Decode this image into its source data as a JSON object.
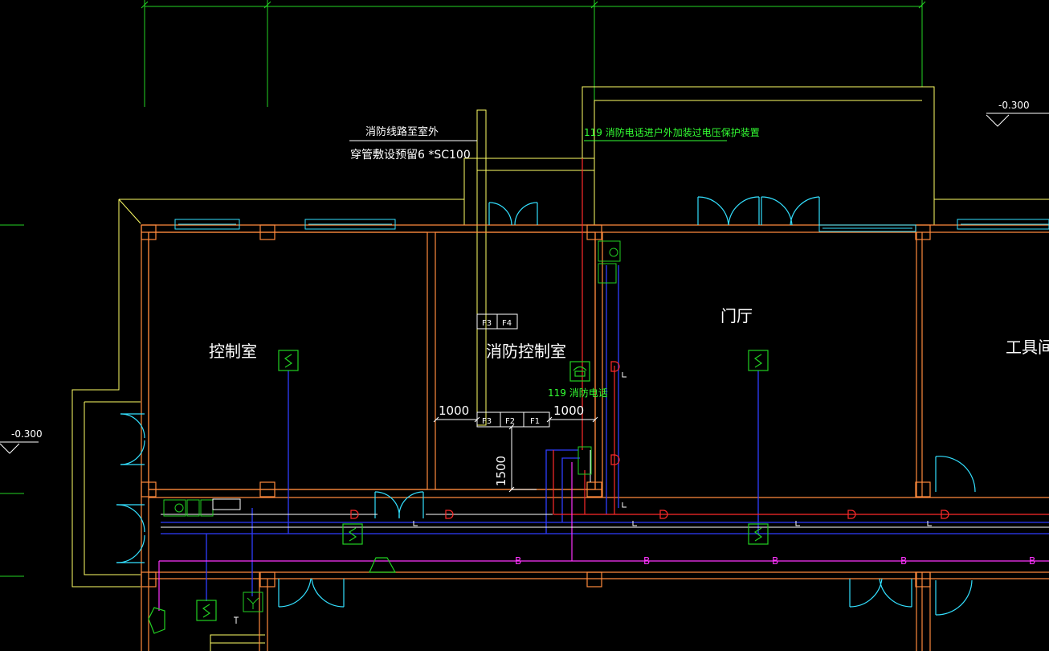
{
  "drawing": {
    "background": "#000000",
    "colors": {
      "wall": "#ff8a3d",
      "grid": "#23d423",
      "pipe": "#ffff66",
      "cyan": "#33e0ff",
      "blue": "#2f3dff",
      "red": "#ff2a2a",
      "magenta": "#ff33ff",
      "white": "#ffffff",
      "green_device": "#22d022",
      "green_text": "#33ff33"
    },
    "rooms": {
      "control_room": "控制室",
      "fire_control_room": "消防控制室",
      "lobby": "门厅",
      "tool_room": "工具间"
    },
    "notes": {
      "line_1": "消防线路至室外",
      "line_2": "穿管敷设预留6 *SC100",
      "phone_note": "119 消防电话进户外加装过电压保护装置",
      "phone_label": "119 消防电话"
    },
    "elevations": {
      "left": "-0.300",
      "right": "-0.300"
    },
    "dimensions": {
      "left": "1000",
      "right": "1000",
      "vertical": "1500"
    },
    "panels": {
      "top": [
        "F3",
        "F4"
      ],
      "bottom": [
        "F3",
        "F2",
        "F1"
      ]
    },
    "icons": [
      "fire-telephone-icon",
      "smoke-detector-icon",
      "speaker-icon",
      "manual-alarm-icon",
      "module-icon",
      "sounder-icon"
    ]
  }
}
